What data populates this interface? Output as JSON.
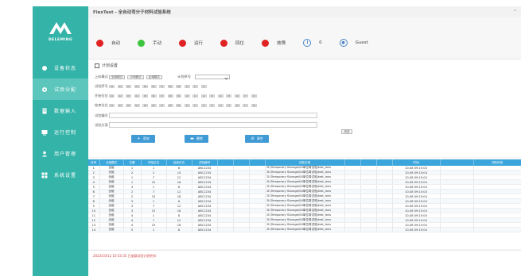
{
  "app": {
    "title": "FlexTest - 全自动弯分子材料试验系统",
    "minimize": "–",
    "logo_text": "DELEMING"
  },
  "colors": {
    "sidebar": "#34b3a8",
    "sidebar_active": "#5cc6bc",
    "accent": "#3f9ad6",
    "table_header": "#3ba6dc",
    "red": "#e02222",
    "green": "#3cc43c",
    "log_red": "#d04040"
  },
  "sidebar": {
    "items": [
      {
        "label": "设备状态",
        "icon": "dot-icon"
      },
      {
        "label": "试验分配",
        "icon": "gear-icon"
      },
      {
        "label": "数据输入",
        "icon": "document-icon"
      },
      {
        "label": "运行控制",
        "icon": "monitor-icon"
      },
      {
        "label": "用户管理",
        "icon": "user-icon"
      },
      {
        "label": "系统设置",
        "icon": "grid-icon"
      }
    ]
  },
  "status": {
    "items": [
      {
        "label": "自动",
        "color": "#e02222"
      },
      {
        "label": "手动",
        "color": "#3cc43c"
      },
      {
        "label": "运行",
        "color": "#e02222"
      },
      {
        "label": "回位",
        "color": "#e02222"
      },
      {
        "label": "故障",
        "color": "#e02222"
      }
    ],
    "counter": "0",
    "user": "Guest"
  },
  "panel": {
    "title": "计划设置",
    "row1": {
      "label": "上料模式",
      "buttons": [
        "全部模式",
        "中间模式",
        "区域模式"
      ],
      "select_label": "计划序号"
    },
    "row2": {
      "label": "试验序号",
      "chips": [
        "01",
        "02",
        "03",
        "04",
        "05",
        "06",
        "07",
        "08",
        "09",
        "10",
        "11",
        "12"
      ]
    },
    "row3": {
      "label": "开始位位",
      "chips": [
        "01",
        "02",
        "03",
        "04",
        "05",
        "06",
        "07",
        "08",
        "09",
        "10",
        "11",
        "12",
        "13",
        "14",
        "15",
        "16",
        "17",
        "18"
      ]
    },
    "row4": {
      "label": "结束位位",
      "chips": [
        "01",
        "02",
        "03",
        "04",
        "05",
        "06",
        "07",
        "08",
        "09",
        "10",
        "11",
        "12",
        "13",
        "14",
        "15",
        "16",
        "17",
        "18"
      ]
    },
    "row5": {
      "label": "试验编号"
    },
    "row6": {
      "label": "试验方案",
      "button": "浏览"
    },
    "actions": [
      "添加",
      "删除",
      "清空"
    ]
  },
  "table": {
    "columns": [
      "序号",
      "分组模式",
      "位置",
      "开始位位",
      "结束位位",
      "试验编号",
      "",
      "",
      "",
      "试验方案",
      "",
      "",
      "",
      "时间",
      "",
      "试验状态"
    ],
    "rows": [
      [
        "1",
        "全组",
        "1",
        "1",
        "8",
        "ABC1234",
        "D:\\Temporary Storage\\04单位弯试验\\test_lans",
        "10-08 09:15:04"
      ],
      [
        "2",
        "全组",
        "2",
        "2",
        "14",
        "ABC1234",
        "D:\\Temporary Storage\\04单位弯试验\\test_lans",
        "10-08 09:15:04"
      ],
      [
        "3",
        "全组",
        "1",
        "7",
        "12",
        "ABC1234",
        "D:\\Temporary Storage\\04单位弯试验\\test_lans",
        "10-08 09:15:04"
      ],
      [
        "4",
        "全组",
        "1",
        "15",
        "16",
        "ABC1234",
        "D:\\Temporary Storage\\04单位弯试验\\test_lans",
        "10-08 09:15:04"
      ],
      [
        "5",
        "全组",
        "3",
        "1",
        "8",
        "ABC1234",
        "D:\\Temporary Storage\\04单位弯试验\\test_lans",
        "10-08 09:15:04"
      ],
      [
        "6",
        "全组",
        "2",
        "7",
        "12",
        "ABC1234",
        "D:\\Temporary Storage\\04单位弯试验\\test_lans",
        "10-08 09:15:04"
      ],
      [
        "7",
        "全组",
        "2",
        "15",
        "18",
        "ABC1234",
        "D:\\Temporary Storage\\04单位弯试验\\test_lans",
        "10-08 09:15:04"
      ],
      [
        "8",
        "全组",
        "3",
        "1",
        "6",
        "ABC1234",
        "D:\\Temporary Storage\\04单位弯试验\\test_lans",
        "10-08 09:15:04"
      ],
      [
        "9",
        "全组",
        "3",
        "7",
        "12",
        "ABC1234",
        "D:\\Temporary Storage\\04单位弯试验\\test_lans",
        "10-08 09:15:04"
      ],
      [
        "10",
        "全组",
        "3",
        "15",
        "18",
        "ABC1234",
        "D:\\Temporary Storage\\04单位弯试验\\test_lans",
        "10-08 09:15:04"
      ],
      [
        "11",
        "全组",
        "4",
        "1",
        "8",
        "ABC1234",
        "D:\\Temporary Storage\\04单位弯试验\\test_lans",
        "10-08 09:15:04"
      ],
      [
        "12",
        "全组",
        "4",
        "7",
        "12",
        "ABC1234",
        "D:\\Temporary Storage\\04单位弯试验\\test_lans",
        "10-08 09:15:04"
      ],
      [
        "13",
        "全组",
        "4",
        "15",
        "18",
        "ABC1234",
        "D:\\Temporary Storage\\04单位弯试验\\test_lans",
        "10-08 09:15:04"
      ],
      [
        "14",
        "全组",
        "5",
        "1",
        "8",
        "ABC1234",
        "D:\\Temporary Storage\\04单位弯试验\\test_lans",
        "10-08 09:15:04"
      ]
    ]
  },
  "log": {
    "message": "2022/10/12 10:53:35  已加载试验计划完毕"
  }
}
